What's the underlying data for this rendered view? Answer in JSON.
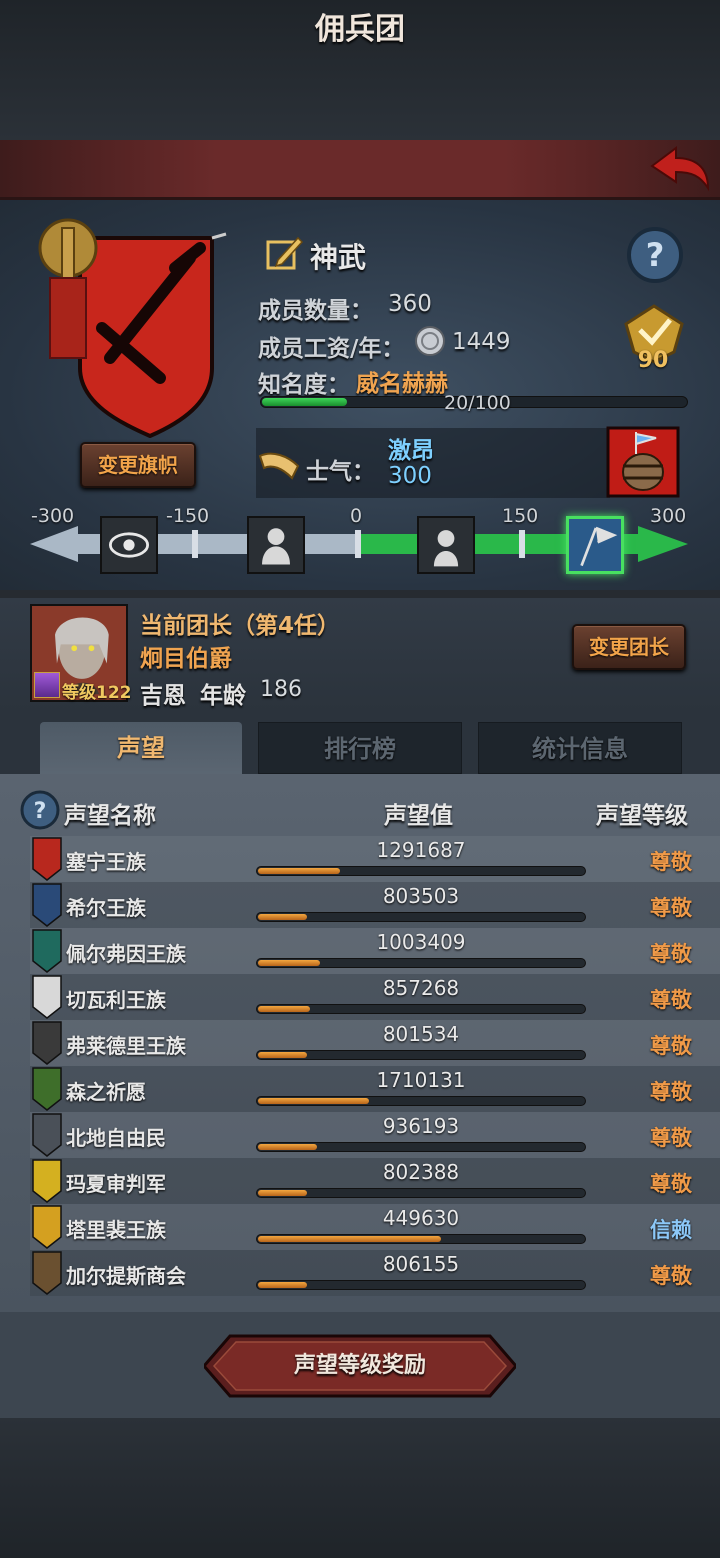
{
  "header": {
    "title": "佣兵团",
    "back_icon": "back-arrow-icon"
  },
  "company": {
    "name": "神武",
    "members_label": "成员数量：",
    "members_value": "360",
    "wage_label": "成员工资/年：",
    "wage_value": "1449",
    "fame_label": "知名度：",
    "fame_value": "威名赫赫",
    "fame_progress": "20/100",
    "fame_fraction": 0.2,
    "change_banner_label": "变更旗帜",
    "badge_value": "90"
  },
  "morale": {
    "label": "士气：",
    "state": "激昂",
    "value": "300",
    "scale_ticks": [
      "-300",
      "-150",
      "0",
      "150",
      "300"
    ],
    "scale_min": -300,
    "scale_max": 300,
    "current": 300
  },
  "leader": {
    "title": "当前团长（第4任）",
    "rank": "炯目伯爵",
    "level": "等级122",
    "name": "吉恩",
    "age_label": "年龄",
    "age": "186",
    "change_label": "变更团长"
  },
  "tabs": [
    "声望",
    "排行榜",
    "统计信息"
  ],
  "reputation": {
    "columns": [
      "声望名称",
      "声望值",
      "声望等级"
    ],
    "rows": [
      {
        "name": "塞宁王族",
        "value": "1291687",
        "fill": 0.25,
        "level": "尊敬",
        "color": "#b8281e"
      },
      {
        "name": "希尔王族",
        "value": "803503",
        "fill": 0.15,
        "level": "尊敬",
        "color": "#2a4a78"
      },
      {
        "name": "佩尔弗因王族",
        "value": "1003409",
        "fill": 0.19,
        "level": "尊敬",
        "color": "#1f6a5e"
      },
      {
        "name": "切瓦利王族",
        "value": "857268",
        "fill": 0.16,
        "level": "尊敬",
        "color": "#d8d8d8"
      },
      {
        "name": "弗莱德里王族",
        "value": "801534",
        "fill": 0.15,
        "level": "尊敬",
        "color": "#3a3a3a"
      },
      {
        "name": "森之祈愿",
        "value": "1710131",
        "fill": 0.34,
        "level": "尊敬",
        "color": "#3e6e2a"
      },
      {
        "name": "北地自由民",
        "value": "936193",
        "fill": 0.18,
        "level": "尊敬",
        "color": "#4a5058"
      },
      {
        "name": "玛夏审判军",
        "value": "802388",
        "fill": 0.15,
        "level": "尊敬",
        "color": "#d4b020"
      },
      {
        "name": "塔里裴王族",
        "value": "449630",
        "fill": 0.56,
        "level": "信赖",
        "color": "#d4a020"
      },
      {
        "name": "加尔提斯商会",
        "value": "806155",
        "fill": 0.15,
        "level": "尊敬",
        "color": "#6a5030"
      }
    ]
  },
  "footer": {
    "reward_label": "声望等级奖励"
  }
}
